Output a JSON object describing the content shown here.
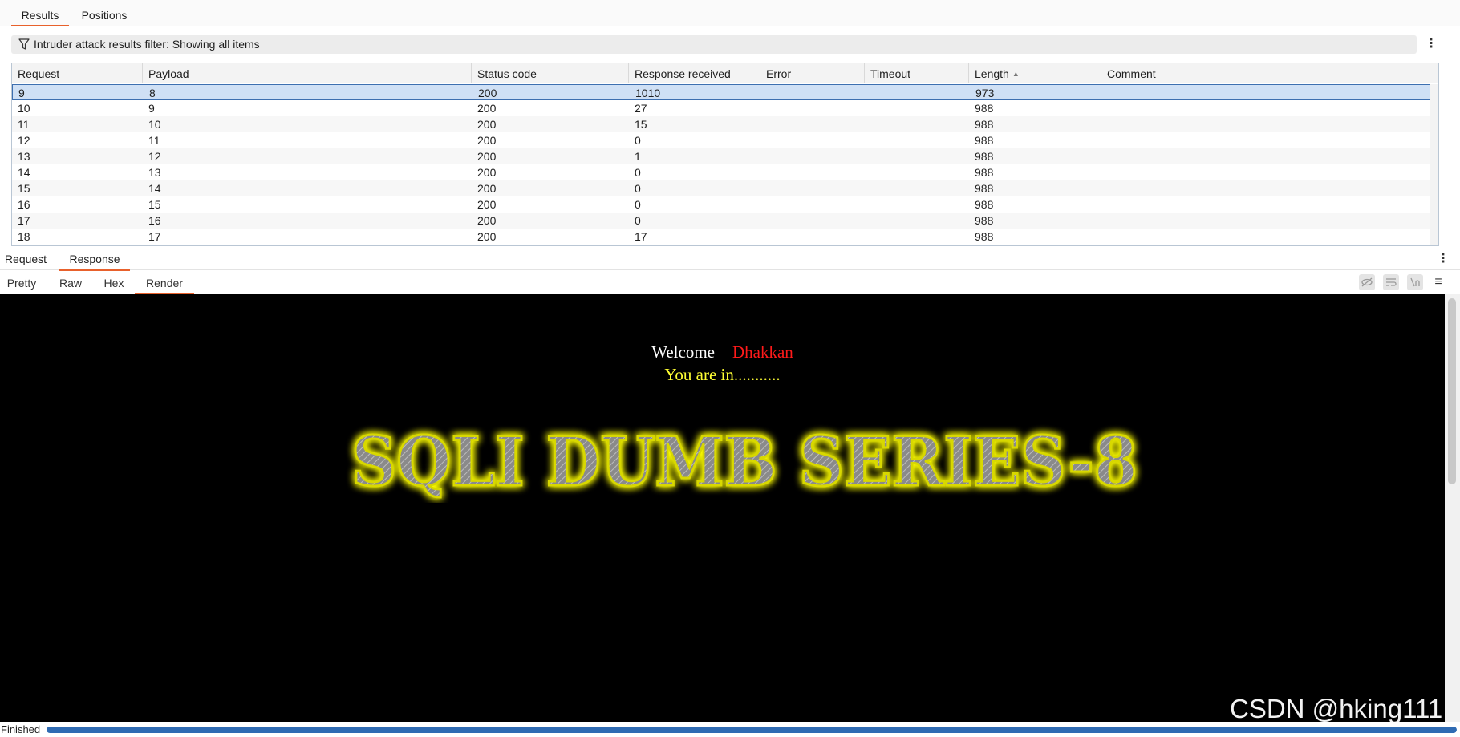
{
  "top_tabs": [
    {
      "label": "Results",
      "active": true
    },
    {
      "label": "Positions",
      "active": false
    }
  ],
  "filter": {
    "text": "Intruder attack results filter: Showing all items"
  },
  "table": {
    "columns": [
      "Request",
      "Payload",
      "Status code",
      "Response received",
      "Error",
      "Timeout",
      "Length",
      "Comment"
    ],
    "sorted_column": "Length",
    "rows": [
      {
        "request": "9",
        "payload": "8",
        "status": "200",
        "received": "1010",
        "error": "",
        "timeout": "",
        "length": "973",
        "comment": "",
        "selected": true
      },
      {
        "request": "10",
        "payload": "9",
        "status": "200",
        "received": "27",
        "error": "",
        "timeout": "",
        "length": "988",
        "comment": ""
      },
      {
        "request": "11",
        "payload": "10",
        "status": "200",
        "received": "15",
        "error": "",
        "timeout": "",
        "length": "988",
        "comment": ""
      },
      {
        "request": "12",
        "payload": "11",
        "status": "200",
        "received": "0",
        "error": "",
        "timeout": "",
        "length": "988",
        "comment": ""
      },
      {
        "request": "13",
        "payload": "12",
        "status": "200",
        "received": "1",
        "error": "",
        "timeout": "",
        "length": "988",
        "comment": ""
      },
      {
        "request": "14",
        "payload": "13",
        "status": "200",
        "received": "0",
        "error": "",
        "timeout": "",
        "length": "988",
        "comment": ""
      },
      {
        "request": "15",
        "payload": "14",
        "status": "200",
        "received": "0",
        "error": "",
        "timeout": "",
        "length": "988",
        "comment": ""
      },
      {
        "request": "16",
        "payload": "15",
        "status": "200",
        "received": "0",
        "error": "",
        "timeout": "",
        "length": "988",
        "comment": ""
      },
      {
        "request": "17",
        "payload": "16",
        "status": "200",
        "received": "0",
        "error": "",
        "timeout": "",
        "length": "988",
        "comment": ""
      },
      {
        "request": "18",
        "payload": "17",
        "status": "200",
        "received": "17",
        "error": "",
        "timeout": "",
        "length": "988",
        "comment": ""
      }
    ]
  },
  "message_tabs": [
    {
      "label": "Request",
      "active": false
    },
    {
      "label": "Response",
      "active": true
    }
  ],
  "view_tabs": [
    {
      "label": "Pretty",
      "active": false
    },
    {
      "label": "Raw",
      "active": false
    },
    {
      "label": "Hex",
      "active": false
    },
    {
      "label": "Render",
      "active": true
    }
  ],
  "toolbar_icons": [
    "hide-icon",
    "word-wrap-icon",
    "newline-icon",
    "menu-icon"
  ],
  "render": {
    "welcome": "Welcome",
    "name": "Dhakkan",
    "message": "You are in...........",
    "banner": "SQLI DUMB SERIES-8",
    "watermark": "CSDN @hking111"
  },
  "status": {
    "text": "Finished",
    "progress_percent": 100
  },
  "colors": {
    "accent": "#e8612c",
    "selection": "#cfe0f5",
    "progress": "#2f6bb3",
    "name_red": "#ff1a1a",
    "message_yellow": "#ffff33"
  }
}
